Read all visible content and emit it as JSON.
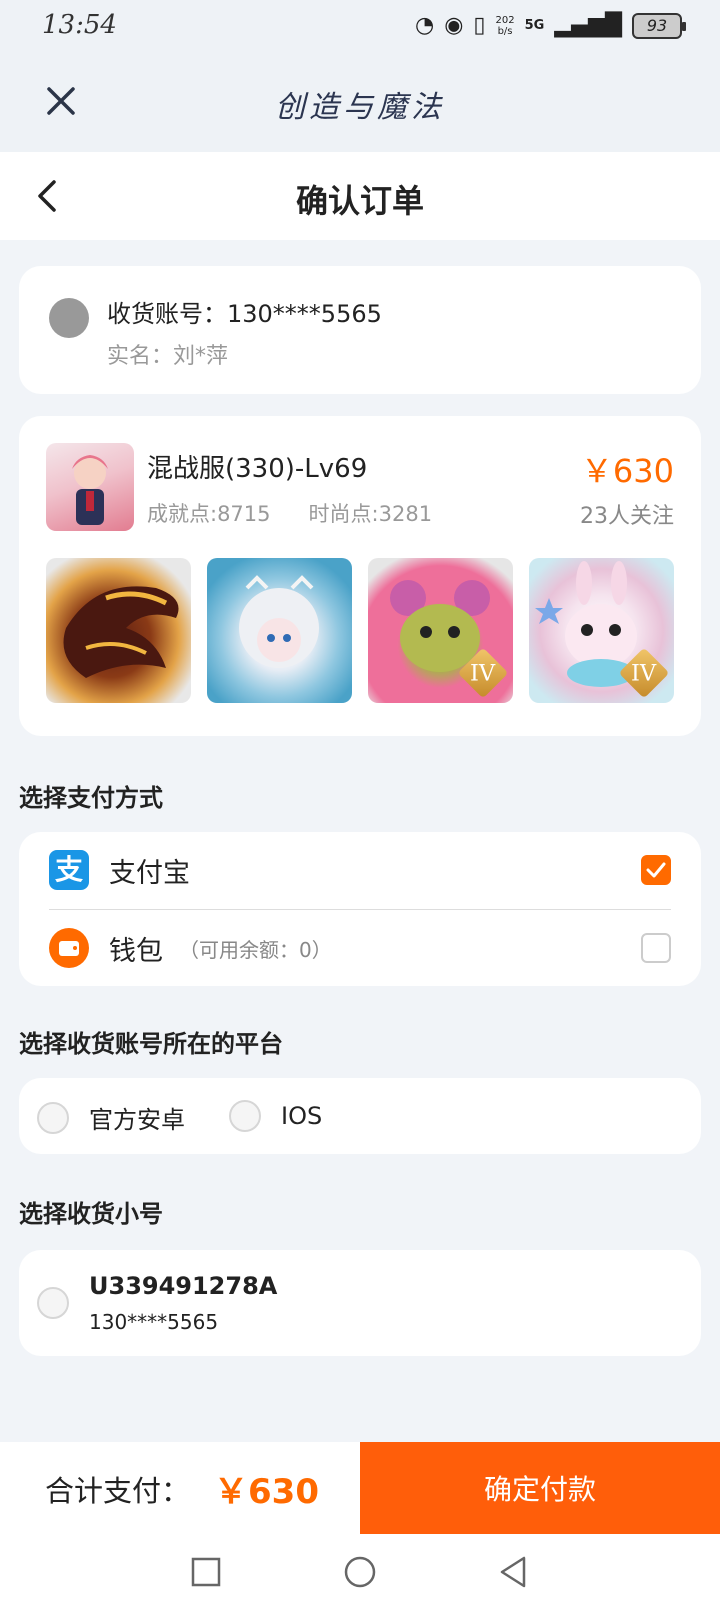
{
  "status_bar": {
    "time": "13:54",
    "network_speed_value": "202",
    "network_speed_unit": "b/s",
    "network_type": "5G",
    "battery": "93"
  },
  "app_header": {
    "title": "创造与魔法"
  },
  "page": {
    "title": "确认订单"
  },
  "account": {
    "label_line": "收货账号：130****5565",
    "realname_line": "实名：刘*萍"
  },
  "product": {
    "name": "混战服(330)-Lv69",
    "achievement": "成就点:8715",
    "fashion": "时尚点:3281",
    "price": "￥630",
    "followers": "23人关注",
    "tier_badges": [
      "IV",
      "IV"
    ]
  },
  "payment": {
    "section_title": "选择支付方式",
    "methods": [
      {
        "label": "支付宝",
        "icon": "alipay-icon",
        "checked": true
      },
      {
        "label": "钱包",
        "sub": "（可用余额：0）",
        "icon": "wallet-icon",
        "checked": false
      }
    ]
  },
  "platform": {
    "section_title": "选择收货账号所在的平台",
    "options": [
      "官方安卓",
      "IOS"
    ]
  },
  "alt_account": {
    "section_title": "选择收货小号",
    "id": "U339491278A",
    "phone": "130****5565"
  },
  "footer": {
    "total_label": "合计支付：",
    "total_amount": "￥630",
    "pay_button": "确定付款"
  },
  "colors": {
    "accent": "#ff6a00",
    "alipay": "#1a96e6"
  }
}
